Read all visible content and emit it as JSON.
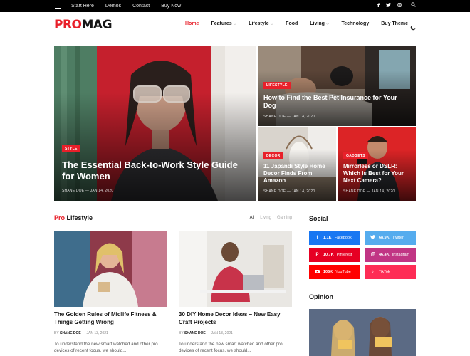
{
  "topbar": {
    "links": [
      "Start Here",
      "Demos",
      "Contact",
      "Buy Now"
    ],
    "social_icons": [
      "facebook-icon",
      "twitter-icon",
      "instagram-icon"
    ]
  },
  "header": {
    "logo_part1": "PRO",
    "logo_part2": "MAG",
    "nav": [
      {
        "label": "Home",
        "active": true,
        "dropdown": false
      },
      {
        "label": "Features",
        "active": false,
        "dropdown": true
      },
      {
        "label": "Lifestyle",
        "active": false,
        "dropdown": true
      },
      {
        "label": "Food",
        "active": false,
        "dropdown": false
      },
      {
        "label": "Living",
        "active": false,
        "dropdown": true
      },
      {
        "label": "Technology",
        "active": false,
        "dropdown": false
      },
      {
        "label": "Buy Theme",
        "active": false,
        "dropdown": false
      }
    ],
    "accent_color": "#e8202a"
  },
  "hero": {
    "main": {
      "tag": "STYLE",
      "title": "The Essential Back-to-Work Style Guide for Women",
      "meta": "SHANE DOE — JAN 14, 2020"
    },
    "top_right": {
      "tag": "LIFESTYLE",
      "title": "How to Find the Best Pet Insurance for Your Dog",
      "meta": "SHANE DOE — JAN 14, 2020"
    },
    "bottom_left": {
      "tag": "DECOR",
      "title": "11 Japandi Style Home Decor Finds From Amazon",
      "meta": "SHANE DOE — JAN 14, 2020"
    },
    "bottom_right": {
      "tag": "GADGETS",
      "title": "Mirrorless or DSLR: Which is Best for Your Next Camera?",
      "meta": "SHANE DOE — JAN 14, 2020"
    }
  },
  "section": {
    "title_accent": "Pro",
    "title_rest": " Lifestyle",
    "filters": [
      "All",
      "Living",
      "Gaming"
    ],
    "cards": [
      {
        "title": "The Golden Rules of Midlife Fitness & Things Getting Wrong",
        "by": "BY",
        "author": "SHANE DOE",
        "date": " — JAN 13, 2021",
        "excerpt": "To understand the new smart watched and other pro devices of recent focus, we should..."
      },
      {
        "title": "30 DIY Home Decor Ideas – New Easy Craft Projects",
        "by": "BY",
        "author": "SHANE DOE",
        "date": " — JAN 13, 2021",
        "excerpt": "To understand the new smart watched and other pro devices of recent focus, we should..."
      }
    ]
  },
  "sidebar": {
    "social_title": "Social",
    "social": [
      {
        "count": "1.1K",
        "name": "Facebook",
        "color": "#1877f2",
        "icon": "facebook-icon"
      },
      {
        "count": "68.9K",
        "name": "Twitter",
        "color": "#55acee",
        "icon": "twitter-icon"
      },
      {
        "count": "10.7K",
        "name": "Pinterest",
        "color": "#e60023",
        "icon": "pinterest-icon"
      },
      {
        "count": "46.4K",
        "name": "Instagram",
        "color": "#c13584",
        "icon": "instagram-icon"
      },
      {
        "count": "105K",
        "name": "YouTube",
        "color": "#ff0000",
        "icon": "youtube-icon"
      },
      {
        "count": "",
        "name": "TikTok",
        "color": "#fe2c55",
        "icon": "tiktok-icon"
      }
    ],
    "opinion_title": "Opinion"
  }
}
